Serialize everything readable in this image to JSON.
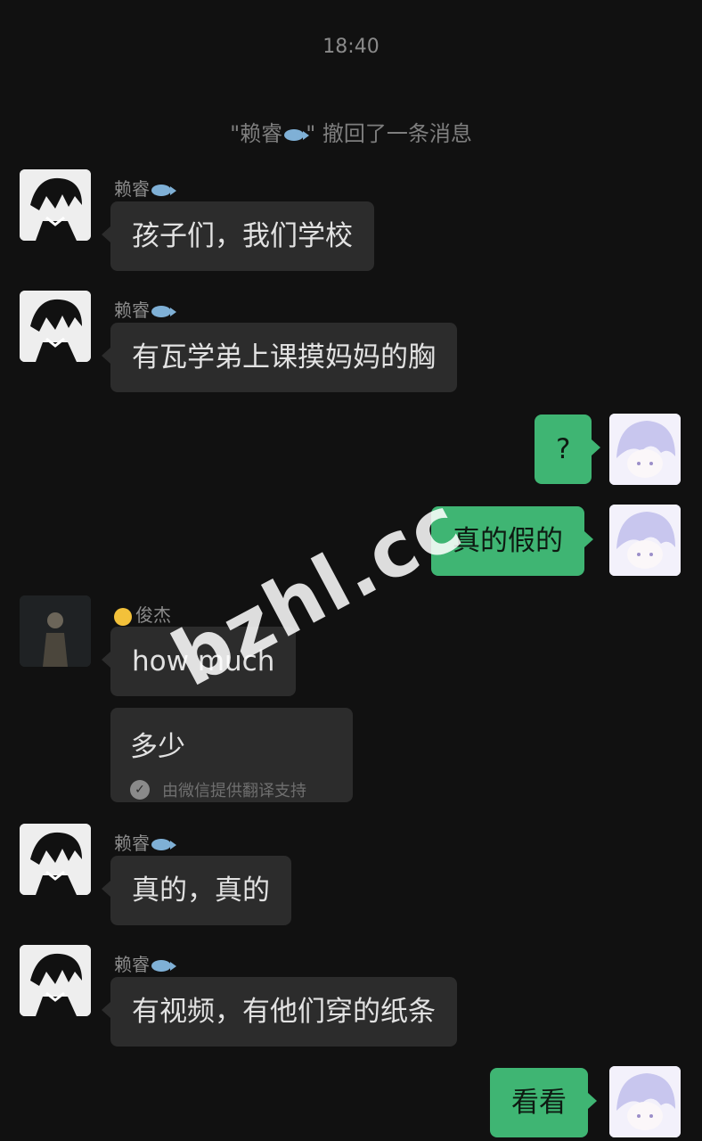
{
  "header": {
    "time": "18:40"
  },
  "system_message": {
    "prefix": "\"赖睿",
    "suffix": "\" 撤回了一条消息",
    "icon": "fish-icon"
  },
  "names": {
    "lairui": "赖睿",
    "junjie": "俊杰"
  },
  "messages": {
    "m1": "孩子们，我们学校",
    "m2": "有瓦学弟上课摸妈妈的胸",
    "m3": "?",
    "m4": "真的假的",
    "m5": "how much",
    "m6": "多少",
    "m6_note": "由微信提供翻译支持",
    "m7": "真的，真的",
    "m8": "有视频，有他们穿的纸条",
    "m9": "看看"
  },
  "watermark": "bzhl.cc",
  "colors": {
    "background": "#111111",
    "incoming_bubble": "#2c2c2c",
    "outgoing_bubble": "#3fb573"
  }
}
